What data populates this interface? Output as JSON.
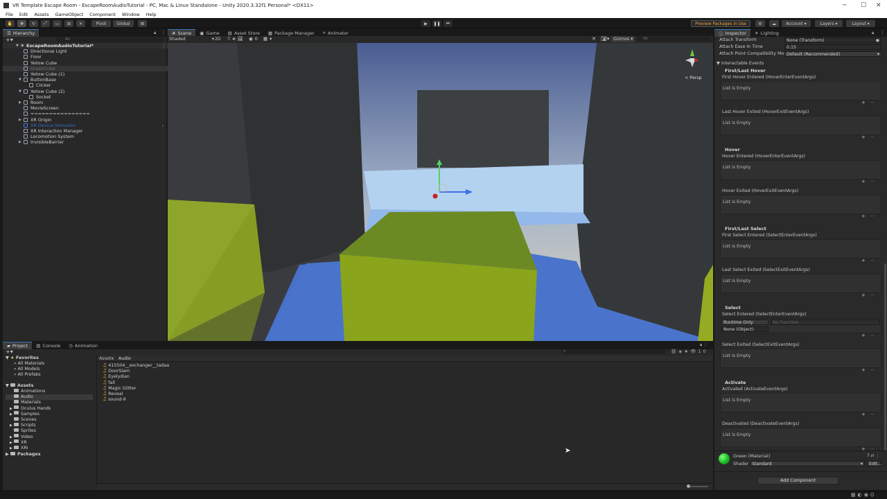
{
  "window": {
    "title": "VR Template Escape Room - EscapeRoomAudioTutorial - PC, Mac & Linux Standalone - Unity 2020.3.32f1 Personal* <DX11>"
  },
  "menu": [
    "File",
    "Edit",
    "Assets",
    "GameObject",
    "Component",
    "Window",
    "Help"
  ],
  "toolbar": {
    "pivot": "Pivot",
    "global": "Global",
    "preview_packages": "Preview Packages in Use",
    "account": "Account",
    "layers": "Layers",
    "layout": "Layout"
  },
  "hierarchy": {
    "tab": "Hierarchy",
    "search_placeholder": "All",
    "scene": "EscapeRoomAudioTutorial*",
    "items": [
      {
        "label": "Directional Light",
        "indent": 1
      },
      {
        "label": "Floor",
        "indent": 1
      },
      {
        "label": "Yellow Cube",
        "indent": 1
      },
      {
        "label": "GreenCube",
        "indent": 1,
        "selected": true,
        "dim": true
      },
      {
        "label": "Yellow Cube (1)",
        "indent": 1
      },
      {
        "label": "ButtonBase",
        "indent": 1,
        "expanded": true
      },
      {
        "label": "Clicker",
        "indent": 2
      },
      {
        "label": "Yellow Cube (2)",
        "indent": 1,
        "expanded": true
      },
      {
        "label": "Socket",
        "indent": 2
      },
      {
        "label": "Room",
        "indent": 1,
        "collapsed": true
      },
      {
        "label": "MovieScreen",
        "indent": 1
      },
      {
        "label": "================",
        "indent": 1
      },
      {
        "label": "XR Origin",
        "indent": 1,
        "collapsed": true
      },
      {
        "label": "XR Device Simulator",
        "indent": 1,
        "blue": true
      },
      {
        "label": "XR Interaction Manager",
        "indent": 1
      },
      {
        "label": "Locomotion System",
        "indent": 1
      },
      {
        "label": "InvisibleBarrier",
        "indent": 1,
        "collapsed": true
      }
    ]
  },
  "scene_view": {
    "tabs": [
      "Scene",
      "Game",
      "Asset Store",
      "Package Manager",
      "Animator"
    ],
    "shading": "Shaded",
    "mode_2d": "2D",
    "gizmos": "Gizmos",
    "search_placeholder": "All",
    "persp": "< Persp"
  },
  "inspector": {
    "tabs": [
      "Inspector",
      "Lighting"
    ],
    "attach_transform_label": "Attach Transform",
    "attach_transform_value": "None (Transform)",
    "attach_ease_label": "Attach Ease In Time",
    "attach_ease_value": "0.15",
    "attach_compat_label": "Attach Point Compatibility Mode",
    "attach_compat_value": "Default (Recommended)",
    "interactable_events": "Interactable Events",
    "list_empty": "List is Empty",
    "sections": [
      {
        "header": "First/Last Hover",
        "events": [
          "First Hover Entered (HoverEnterEventArgs)",
          "Last Hover Exited (HoverExitEventArgs)"
        ]
      },
      {
        "header": "Hover",
        "events": [
          "Hover Entered (HoverEnterEventArgs)",
          "Hover Exited (HoverExitEventArgs)"
        ]
      },
      {
        "header": "First/Last Select",
        "events": [
          "First Select Entered (SelectEnterEventArgs)",
          "Last Select Exited (SelectExitEventArgs)"
        ]
      },
      {
        "header": "Select",
        "events": [
          "Select Entered (SelectEnterEventArgs)",
          "Select Exited (SelectExitEventArgs)"
        ]
      },
      {
        "header": "Activate",
        "events": [
          "Activated (ActivateEventArgs)",
          "Deactivated (DeactivateEventArgs)"
        ]
      }
    ],
    "select_entered_runtime": "Runtime Only",
    "select_entered_function": "No Function",
    "select_entered_object": "None (Object)",
    "material_name": "Green (Material)",
    "shader_label": "Shader",
    "shader_value": "Standard",
    "edit": "Edit...",
    "add_component": "Add Component"
  },
  "project": {
    "tabs": [
      "Project",
      "Console",
      "Animation"
    ],
    "favorites": "Favorites",
    "favorites_items": [
      "All Materials",
      "All Models",
      "All Prefabs"
    ],
    "assets": "Assets",
    "assets_items": [
      "Animations",
      "Audio",
      "Materials",
      "Oculus Hands",
      "Samples",
      "Scenes",
      "Scripts",
      "Sprites",
      "Video",
      "XR",
      "XRI"
    ],
    "packages": "Packages",
    "breadcrumb": [
      "Assets",
      "Audio"
    ],
    "files": [
      "415504__exchanger__tadaa",
      "DoorSlam",
      "Eyelydian",
      "fall",
      "Magic Glitter",
      "Reveal",
      "sound-9"
    ],
    "count": "10"
  },
  "colors": {
    "accent": "#3a79bb",
    "panel": "#282828",
    "yellow_cube": "#8aa51b",
    "floor": "#4a70c0"
  }
}
